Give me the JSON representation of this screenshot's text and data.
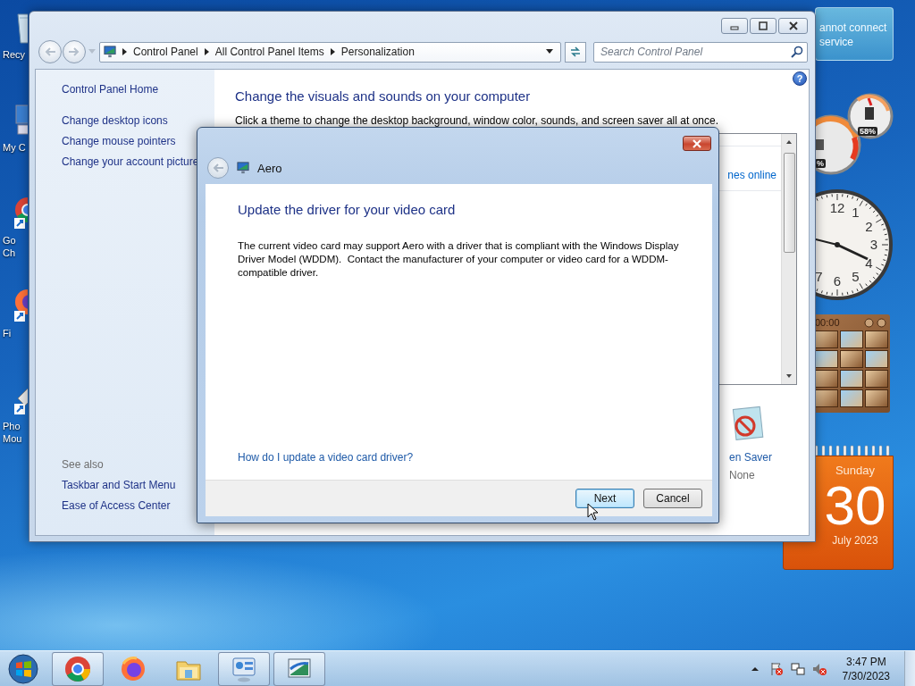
{
  "desktop_icons": [
    {
      "kind": "recycle-bin",
      "lines": [
        "Recy"
      ]
    },
    {
      "kind": "computer",
      "lines": [
        "My C"
      ]
    },
    {
      "kind": "chrome",
      "lines": [
        "Go",
        "Ch"
      ]
    },
    {
      "kind": "firefox",
      "lines": [
        "Fi"
      ]
    },
    {
      "kind": "device",
      "lines": [
        "Pho",
        "Mou"
      ]
    }
  ],
  "notification": {
    "lines": [
      "annot connect",
      "service"
    ]
  },
  "cpu_meter": {
    "readings": [
      "%",
      "58%"
    ]
  },
  "clock": {
    "numerals": [
      "12",
      "1",
      "2",
      "3",
      "4",
      "5",
      "6",
      "7"
    ]
  },
  "puzzle": {
    "timer": "00:00"
  },
  "calendar": {
    "weekday": "Sunday",
    "day": "30",
    "month_year": "July 2023"
  },
  "window": {
    "breadcrumb": [
      "Control Panel",
      "All Control Panel Items",
      "Personalization"
    ],
    "search": {
      "placeholder": "Search Control Panel"
    },
    "help": "?",
    "sidebar": {
      "items": [
        "Control Panel Home",
        "Change desktop icons",
        "Change mouse pointers",
        "Change your account picture"
      ],
      "see_also": {
        "heading": "See also",
        "items": [
          "Taskbar and Start Menu",
          "Ease of Access Center"
        ]
      }
    },
    "heading": "Change the visuals and sounds on your computer",
    "description": "Click a theme to change the desktop background, window color, sounds, and screen saver all at once.",
    "themes_link": "nes online",
    "screen_saver": {
      "label": "en Saver",
      "value": "None"
    }
  },
  "dialog": {
    "title": "Aero",
    "heading": "Update the driver for your video card",
    "body": "The current video card may support Aero with a driver that is compliant with the Windows Display Driver Model (WDDM).  Contact the manufacturer of your computer or video card for a WDDM-compatible driver.",
    "link": "How do I update a video card driver?",
    "buttons": [
      {
        "label": "Next",
        "default": true
      },
      {
        "label": "Cancel",
        "default": false
      }
    ]
  },
  "taskbar": {
    "apps": [
      {
        "kind": "chrome",
        "active": true
      },
      {
        "kind": "firefox",
        "active": false
      },
      {
        "kind": "explorer",
        "active": false
      },
      {
        "kind": "control-panel",
        "active": true
      },
      {
        "kind": "display",
        "active": true
      }
    ],
    "time": "3:47 PM",
    "date": "7/30/2023"
  }
}
